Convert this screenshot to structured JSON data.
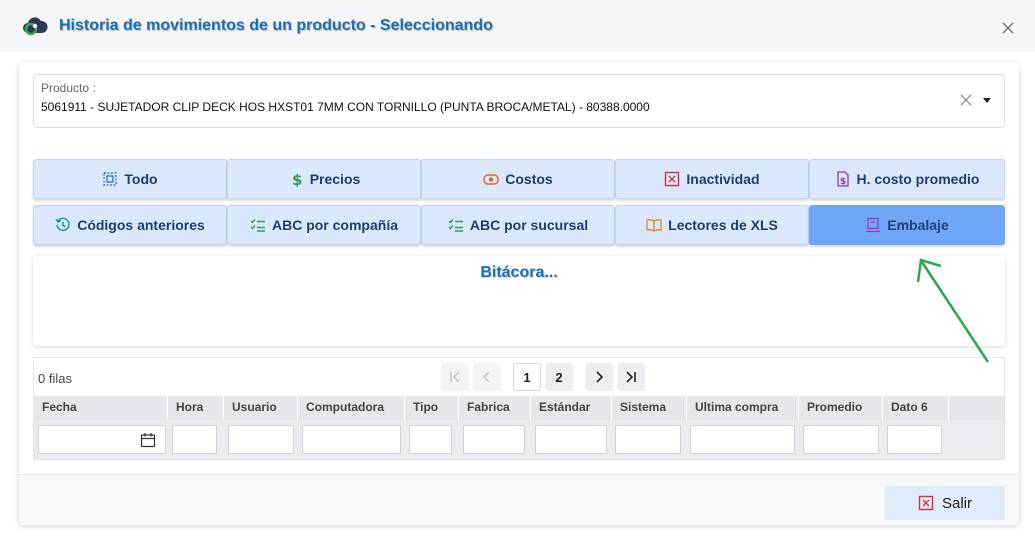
{
  "window": {
    "title": "Historia de movimientos de un producto - Seleccionando",
    "logo_icon": "cloud-logo-icon",
    "close_icon": "close-icon"
  },
  "product": {
    "label": "Producto :",
    "value": "5061911 - SUJETADOR CLIP DECK HOS HXST01 7MM CON TORNILLO (PUNTA BROCA/METAL) - 80388.0000"
  },
  "tabs": [
    {
      "label": "Todo",
      "icon": "select-all-icon",
      "color": "#1b6fb3"
    },
    {
      "label": "Precios",
      "icon": "dollar-icon",
      "color": "#2e9e55"
    },
    {
      "label": "Costos",
      "icon": "money-icon",
      "color": "#e0662a"
    },
    {
      "label": "Inactividad",
      "icon": "x-square-icon",
      "color": "#d0343a"
    },
    {
      "label": "H. costo promedio",
      "icon": "document-dollar-icon",
      "color": "#8e3bb7"
    },
    {
      "label": "Códigos anteriores",
      "icon": "history-icon",
      "color": "#1a9a8a"
    },
    {
      "label": "ABC por compañía",
      "icon": "checklist-icon",
      "color": "#2e9e55"
    },
    {
      "label": "ABC por sucursal",
      "icon": "checklist-icon",
      "color": "#2e9e55"
    },
    {
      "label": "Lectores de XLS",
      "icon": "open-book-icon",
      "color": "#e0872a"
    },
    {
      "label": "Embalaje",
      "icon": "package-icon",
      "color": "#9a3bb7",
      "active": true
    }
  ],
  "log": {
    "title": "Bitácora..."
  },
  "grid": {
    "rows_label": "0 filas",
    "pagination": {
      "pages": [
        "1",
        "2"
      ],
      "current": "1"
    },
    "columns": [
      "Fecha",
      "Hora",
      "Usuario",
      "Computadora",
      "Tipo",
      "Fabrica",
      "Estándar",
      "Sistema",
      "Ultima compra",
      "Promedio",
      "Dato 6"
    ]
  },
  "footer": {
    "exit_label": "Salir"
  },
  "colors": {
    "accent": "#1b6fb3",
    "tab_bg": "#dbe8fb",
    "tab_active_bg": "#6fa6f5",
    "annotation_arrow": "#2ea84a"
  }
}
